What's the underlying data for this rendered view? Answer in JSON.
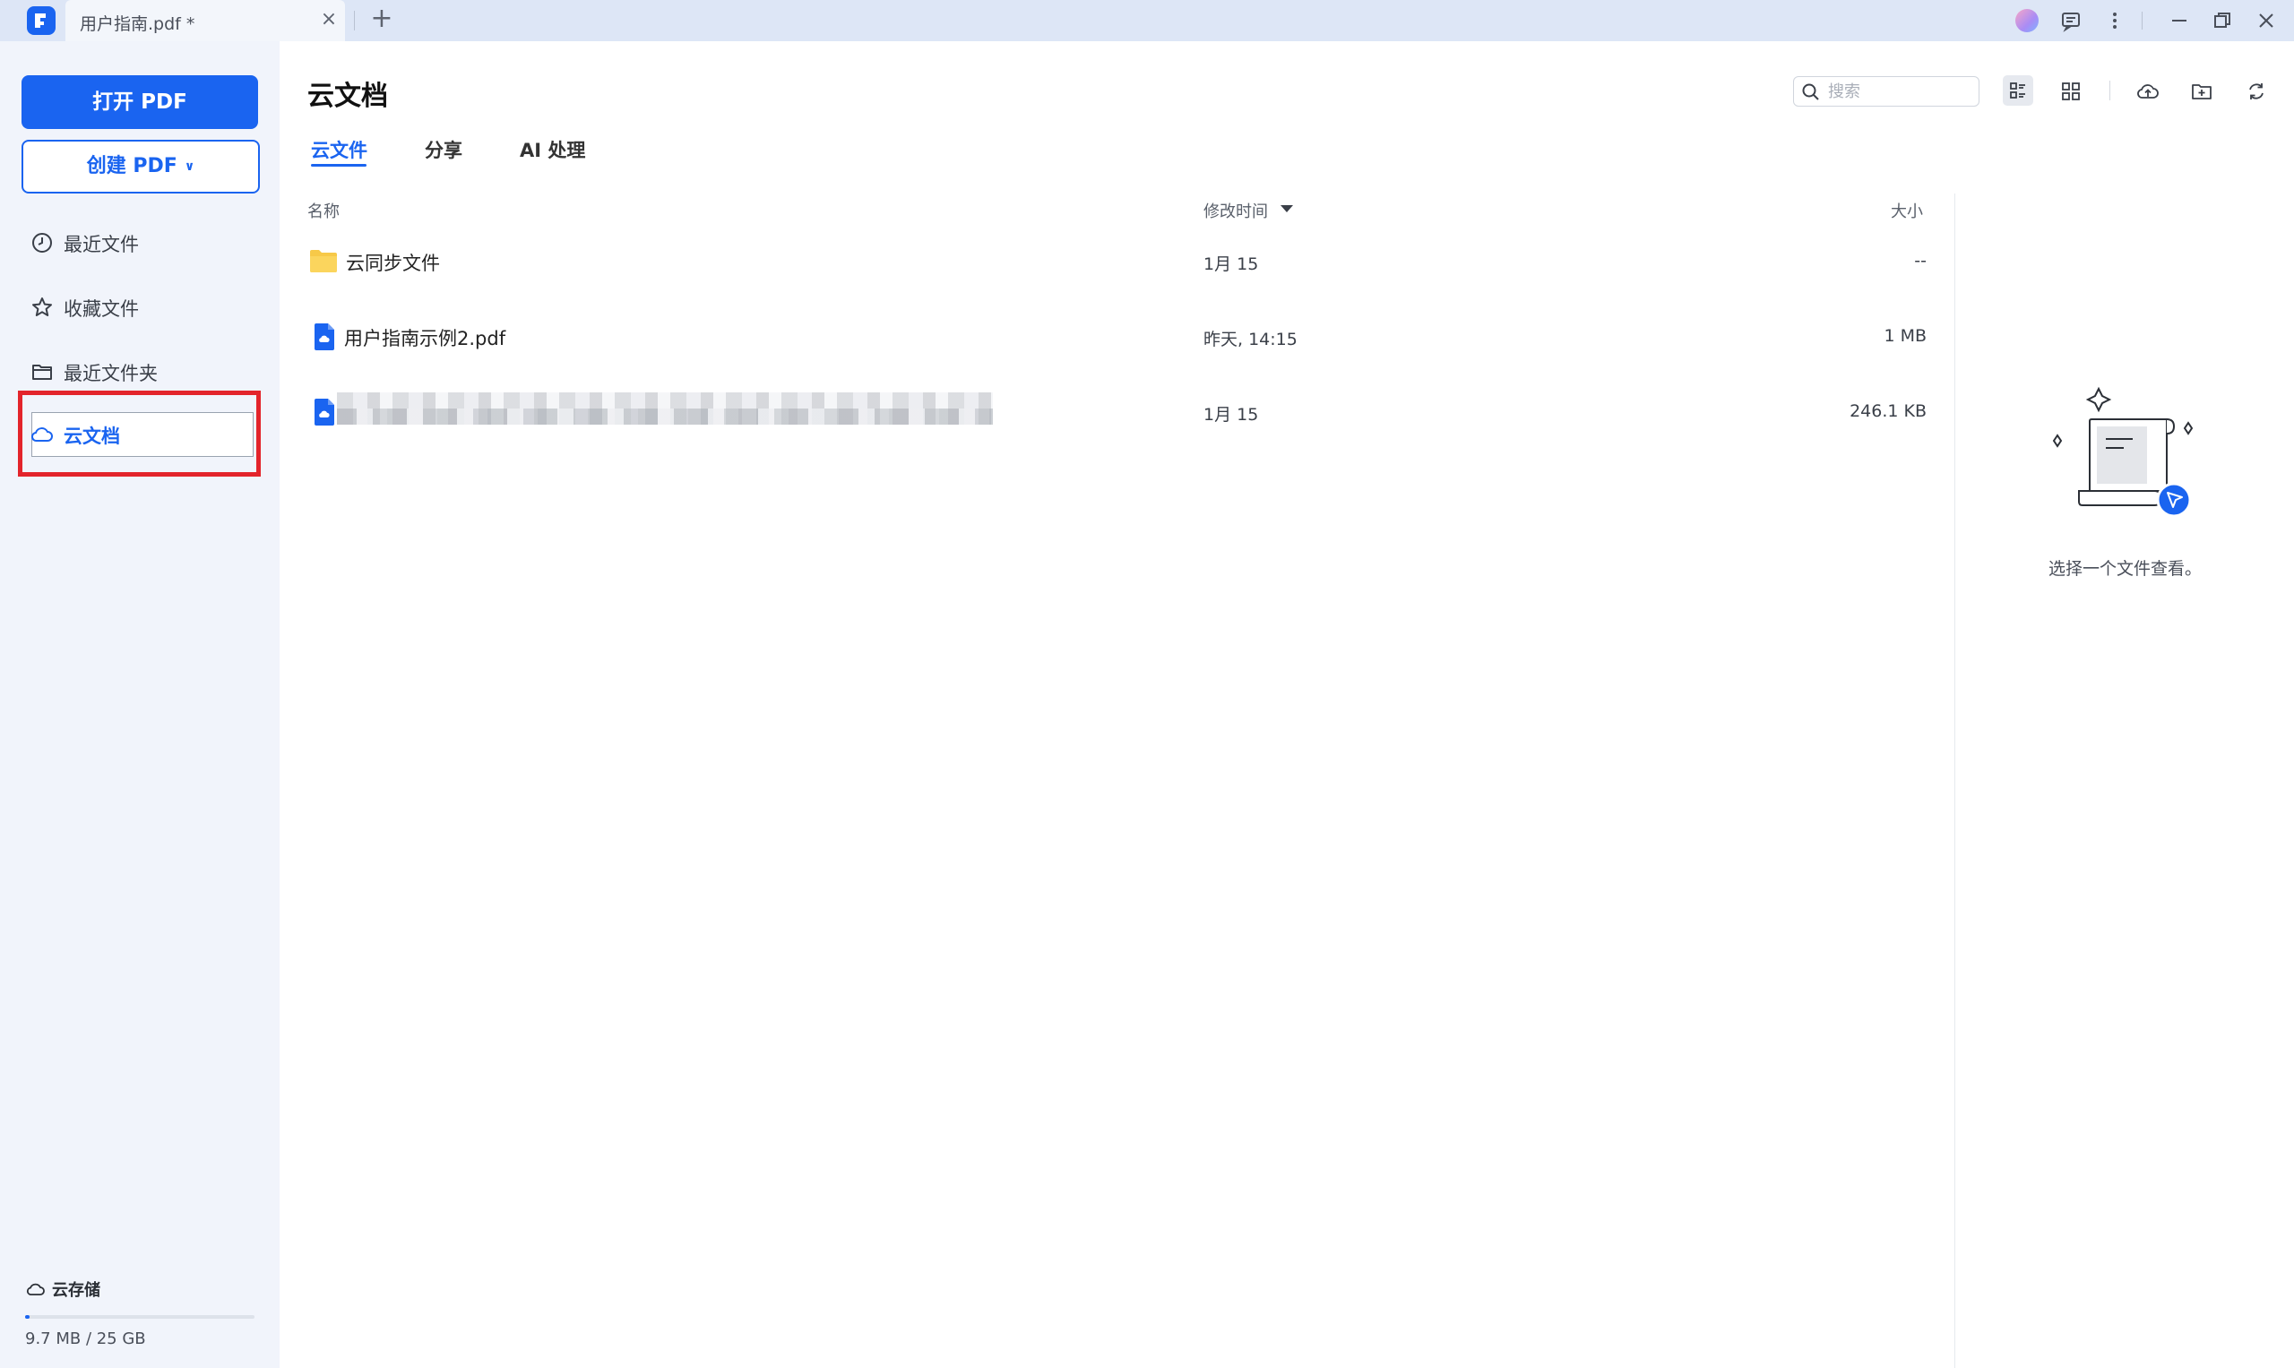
{
  "titlebar": {
    "tab_title": "用户指南.pdf *",
    "close_glyph": "×",
    "add_glyph": "+"
  },
  "sidebar": {
    "open_pdf_label": "打开 PDF",
    "create_pdf_label": "创建 PDF",
    "nav": [
      {
        "label": "最近文件",
        "icon": "clock-icon"
      },
      {
        "label": "收藏文件",
        "icon": "star-icon"
      },
      {
        "label": "最近文件夹",
        "icon": "folder-icon"
      },
      {
        "label": "云文档",
        "icon": "cloud-icon",
        "active": true
      }
    ],
    "storage": {
      "title": "云存储",
      "usage": "9.7 MB / 25 GB",
      "used_fraction": 0.0004
    }
  },
  "main": {
    "title": "云文档",
    "tabs": [
      {
        "label": "云文件",
        "active": true
      },
      {
        "label": "分享"
      },
      {
        "label": "AI 处理"
      }
    ],
    "search_placeholder": "搜索",
    "columns": {
      "name": "名称",
      "modified": "修改时间",
      "size": "大小"
    },
    "rows": [
      {
        "type": "folder",
        "name": "云同步文件",
        "modified": "1月 15",
        "size": "--"
      },
      {
        "type": "pdf",
        "name": "用户指南示例2.pdf",
        "modified": "昨天, 14:15",
        "size": "1 MB"
      },
      {
        "type": "pdf",
        "name": "",
        "modified": "1月 15",
        "size": "246.1 KB",
        "blurred": true
      }
    ],
    "detail_empty_text": "选择一个文件查看。"
  },
  "colors": {
    "accent": "#1a64f0",
    "highlight": "#e3242b",
    "folder": "#f7c948"
  }
}
